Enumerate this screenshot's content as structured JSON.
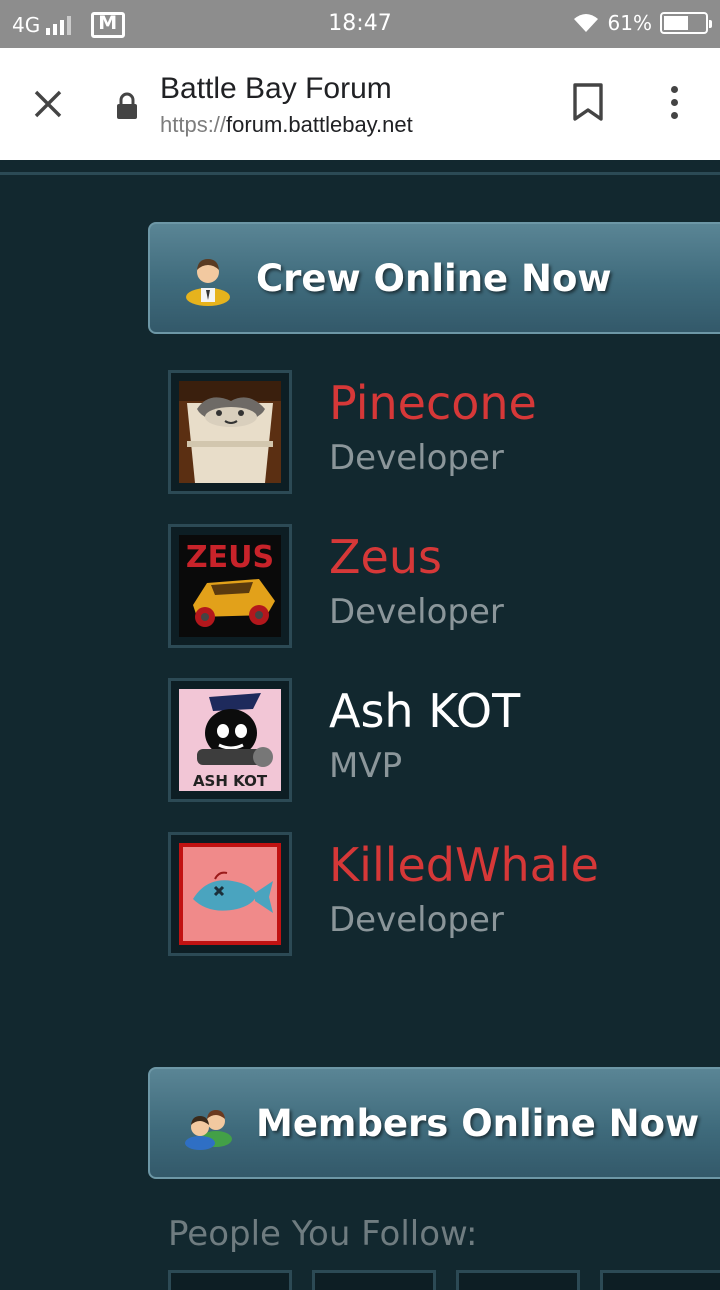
{
  "status_bar": {
    "network": "4G",
    "time": "18:47",
    "battery_percent": "61%",
    "battery_level": 0.61
  },
  "browser": {
    "page_title": "Battle Bay Forum",
    "url_scheme": "https://",
    "url_host": "forum.battlebay.net",
    "icons": [
      "close-icon",
      "lock-icon",
      "bookmark-icon",
      "more-vert-icon"
    ]
  },
  "crew_section": {
    "title": "Crew Online Now",
    "icon": "crew-person-icon",
    "members": [
      {
        "name": "Pinecone",
        "role": "Developer",
        "name_color": "#d63838",
        "avatar": "cat-in-box-avatar"
      },
      {
        "name": "Zeus",
        "role": "Developer",
        "name_color": "#d63838",
        "avatar": "zeus-car-avatar",
        "avatar_text": "ZEUS"
      },
      {
        "name": "Ash KOT",
        "role": "MVP",
        "name_color": "#ffffff",
        "avatar": "ash-kot-avatar",
        "avatar_text": "ASH KOT"
      },
      {
        "name": "KilledWhale",
        "role": "Developer",
        "name_color": "#d63838",
        "avatar": "dead-whale-avatar"
      }
    ]
  },
  "members_section": {
    "title": "Members Online Now",
    "icon": "members-group-icon",
    "follow_label": "People You Follow:"
  }
}
